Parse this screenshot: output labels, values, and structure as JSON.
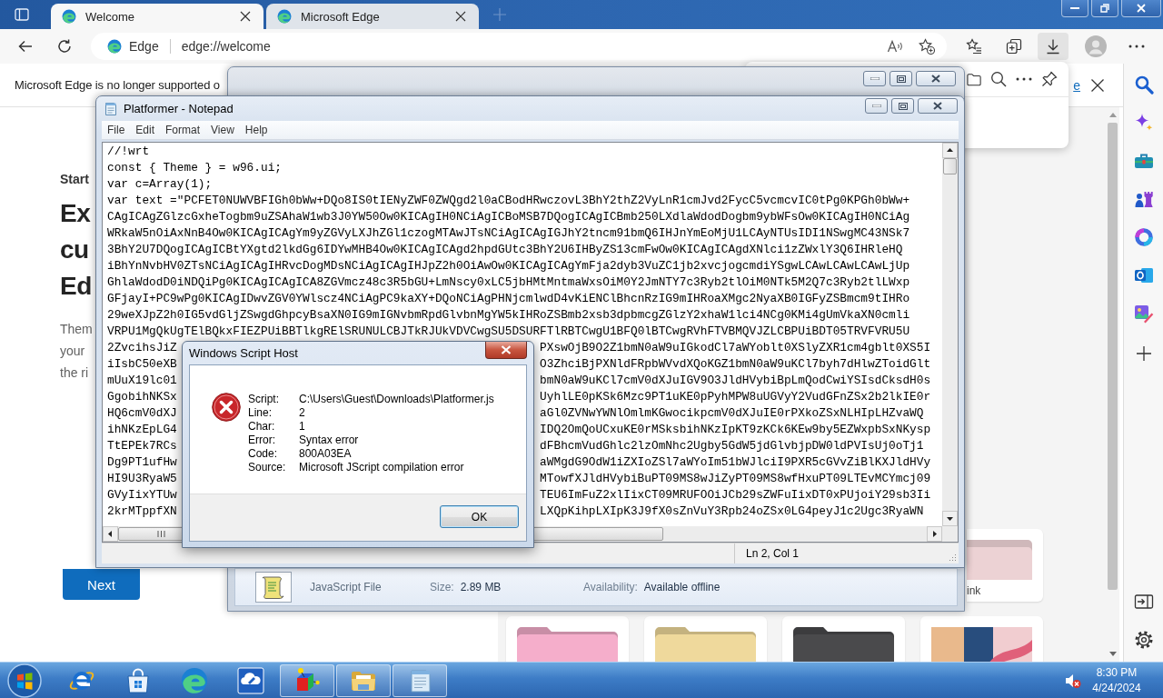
{
  "browser": {
    "tabs": [
      {
        "title": "Welcome",
        "selected": true
      },
      {
        "title": "Microsoft Edge",
        "selected": false
      }
    ],
    "address_bar": {
      "site_label": "Edge",
      "url": "edge://welcome",
      "downloads_selected": true
    },
    "notification": {
      "message": "Microsoft Edge is no longer supported o",
      "link": "e"
    },
    "page": {
      "eyebrow": "Start",
      "heading_lines": [
        "Ex",
        "cu",
        "Ed"
      ],
      "body_lines": [
        "Them",
        "your",
        "the ri"
      ],
      "button": "Next",
      "theme_cards": {
        "top_row": [
          {
            "kind": "folder",
            "color": "#ecd2d4",
            "label": "ink"
          }
        ],
        "bottom_row": [
          {
            "kind": "folder",
            "color": "#f5aecb"
          },
          {
            "kind": "folder",
            "color": "#efd99c"
          },
          {
            "kind": "folder",
            "color": "#4a4a4c"
          },
          {
            "kind": "photo"
          }
        ]
      }
    }
  },
  "explorer": {
    "details": {
      "file_type": "JavaScript File",
      "fields": [
        {
          "label": "Size:",
          "value": "2.89 MB"
        },
        {
          "label": "Availability:",
          "value": "Available offline"
        }
      ]
    }
  },
  "notepad": {
    "title": "Platformer - Notepad",
    "menu": [
      "File",
      "Edit",
      "Format",
      "View",
      "Help"
    ],
    "lines": [
      {
        "kind": "full",
        "text": "//!wrt"
      },
      {
        "kind": "full",
        "text": "const { Theme } = w96.ui;"
      },
      {
        "kind": "full",
        "text": "var c=Array(1);"
      },
      {
        "kind": "full",
        "text": "var text =\"PCFET0NUWVBFIGh0bWw+DQo8IS0tIENyZWF0ZWQgd2l0aCBodHRwczovL3BhY2thZ2VyLnR1cmJvd2FycC5vcmcvIC0tPg0KPGh0bWw+"
      },
      {
        "kind": "full",
        "text": "CAgICAgZGlzcGxheTogbm9uZSAhaW1wb3J0YW50Ow0KICAgIH0NCiAgICBoMSB7DQogICAgICBmb250LXdlaWdodDogbm9ybWFsOw0KICAgIH0NCiAg"
      },
      {
        "kind": "full",
        "text": "WRkaW5nOiAxNnB4Ow0KICAgICAgYm9yZGVyLXJhZGl1czogMTAwJTsNCiAgICAgIGJhY2tncm91bmQ6IHJnYmEoMjU1LCAyNTUsIDI1NSwgMC43NSk7"
      },
      {
        "kind": "full",
        "text": "3BhY2U7DQogICAgICBtYXgtd2lkdGg6IDYwMHB4Ow0KICAgICAgd2hpdGUtc3BhY2U6IHByZS13cmFwOw0KICAgICAgdXNlci1zZWxlY3Q6IHRleHQ"
      },
      {
        "kind": "full",
        "text": "iBhYnNvbHV0ZTsNCiAgICAgIHRvcDogMDsNCiAgICAgIHJpZ2h0OiAwOw0KICAgICAgYmFja2dyb3VuZC1jb2xvcjogcmdiYSgwLCAwLCAwLCAwLjUp"
      },
      {
        "kind": "full",
        "text": "GhlaWdodD0iNDQiPg0KICAgICAgICA8ZGVmcz48c3R5bGU+LmNscy0xLC5jbHMtMntmaWxsOiM0Y2JmNTY7c3Ryb2tlOiM0NTk5M2Q7c3Ryb2tlLWxp"
      },
      {
        "kind": "full",
        "text": "GFjayI+PC9wPg0KICAgIDwvZGV0YWlscz4NCiAgPC9kaXY+DQoNCiAgPHNjcmlwdD4vKiENClBhcnRzIG9mIHRoaXMgc2NyaXB0IGFyZSBmcm9tIHRo"
      },
      {
        "kind": "full",
        "text": "29weXJpZ2h0IG5vdGljZSwgdGhpcyBsaXN0IG9mIGNvbmRpdGlvbnMgYW5kIHRoZSBmb2xsb3dpbmcgZGlzY2xhaW1lci4NCg0KMi4gUmVkaXN0cmli"
      },
      {
        "kind": "full",
        "text": "VRPU1MgQkUgTElBQkxFIEZPUiBBTlkgRElSRUNULCBJTkRJUkVDVCwgSU5DSURFTlRBTCwgU1BFQ0lBTCwgRVhFTVBMQVJZLCBPUiBDT05TRVFVRU5U"
      },
      {
        "kind": "covered",
        "start": "2ZvcihsJiZ",
        "end": "PXswOjB9O2Z1bmN0aW9uIGkodCl7aWYoblt0XSlyZXR1cm4gblt0XS5I"
      },
      {
        "kind": "covered",
        "start": "iIsbC50eXB",
        "end": "O3ZhciBjPXNldFRpbWVvdXQoKGZ1bmN0aW9uKCl7byh7dHlwZToidGlt"
      },
      {
        "kind": "covered",
        "start": "mUuX19lc01",
        "end": "bmN0aW9uKCl7cmV0dXJuIGV9O3JldHVybiBpLmQodCwiYSIsdCksdH0s"
      },
      {
        "kind": "covered",
        "start": "GgobihNKSx",
        "end": "UyhlLE0pKSk6Mzc9PT1uKE0pPyhMPW8uUGVyY2VudGFnZSx2b2lkIE0r"
      },
      {
        "kind": "covered",
        "start": "HQ6cmV0dXJ",
        "end": "aGl0ZVNwYWNlOmlmKGwocikpcmV0dXJuIE0rPXkoZSxNLHIpLHZvaWQ"
      },
      {
        "kind": "covered",
        "start": "ihNKzEpLG4",
        "end": "IDQ2OmQoUCxuKE0rMSksbihNKzIpKT9zKCk6KEw9by5EZWxpbSxNKysp"
      },
      {
        "kind": "covered",
        "start": "TtEPEk7RCs",
        "end": "dFBhcmVudGhlc2lzOmNhc2Ugby5GdW5jdGlvbjpDW0ldPVIsUj0oTj1"
      },
      {
        "kind": "covered",
        "start": "Dg9PT1ufHw",
        "end": "aWMgdG9OdW1iZXIoZSl7aWYoIm51bWJlciI9PXR5cGVvZiBlKXJldHVy"
      },
      {
        "kind": "covered",
        "start": "HI9U3RyaW5",
        "end": "MTowfXJldHVybiBuPT09MS8wJiZyPT09MS8wfHxuPT09LTEvMCYmcj09"
      },
      {
        "kind": "covered",
        "start": "GVyIixYTUw",
        "end": "TEU6ImFuZ2xlIixCT09MRUFOOiJCb29sZWFuIixDT0xPUjoiY29sb3Ii"
      },
      {
        "kind": "covered",
        "start": "2krMTppfXN",
        "end": "LXQpKihpLXIpK3J9fX0sZnVuY3Rpb24oZSx0LG4peyJ1c2Ugc3RyaWN"
      }
    ],
    "status": "Ln 2, Col 1"
  },
  "dialog": {
    "title": "Windows Script Host",
    "fields": [
      {
        "label": "Script:",
        "value": "C:\\Users\\Guest\\Downloads\\Platformer.js"
      },
      {
        "label": "Line:",
        "value": "2"
      },
      {
        "label": "Char:",
        "value": "1"
      },
      {
        "label": "Error:",
        "value": "Syntax error"
      },
      {
        "label": "Code:",
        "value": "800A03EA"
      },
      {
        "label": "Source:",
        "value": "Microsoft JScript compilation error"
      }
    ],
    "button": "OK"
  },
  "taskbar": {
    "apps": [
      {
        "running": false
      },
      {
        "running": false
      },
      {
        "running": false
      },
      {
        "running": false
      },
      {
        "running": true
      },
      {
        "running": true
      },
      {
        "running": true
      }
    ],
    "volume_muted": true,
    "clock": {
      "time": "8:30 PM",
      "date": "4/24/2024"
    }
  }
}
